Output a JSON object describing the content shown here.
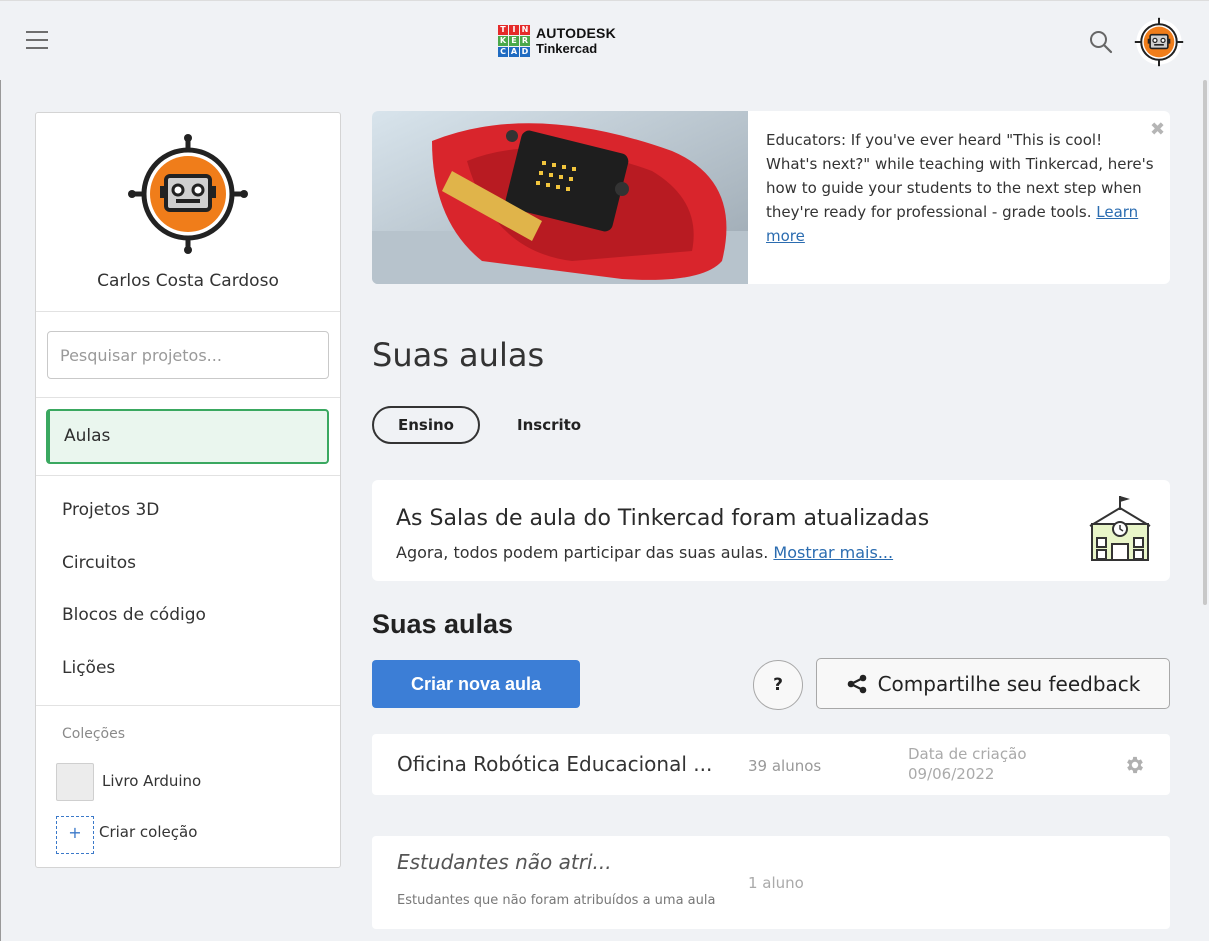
{
  "header": {
    "logo_letters": [
      "T",
      "I",
      "N",
      "K",
      "E",
      "R",
      "C",
      "A",
      "D"
    ],
    "logo_colors": [
      "#e52b2a",
      "#e52b2a",
      "#e52b2a",
      "#4aa84a",
      "#4aa84a",
      "#4aa84a",
      "#1f6bc1",
      "#1f6bc1",
      "#1f6bc1"
    ],
    "brand": "AUTODESK",
    "product": "Tinkercad"
  },
  "sidebar": {
    "user_name": "Carlos Costa Cardoso",
    "search_placeholder": "Pesquisar projetos...",
    "active_item": "Aulas",
    "nav_items": [
      "Projetos 3D",
      "Circuitos",
      "Blocos de código",
      "Lições"
    ],
    "collections_title": "Coleções",
    "collection_name": "Livro Arduino",
    "create_collection_icon": "+",
    "create_collection_label": "Criar coleção"
  },
  "banner": {
    "text": "Educators: If you've ever heard \"This is cool! What's next?\" while teaching with Tinkercad, here's how to guide your students to the next step when they're ready for professional - grade tools. ",
    "link": "Learn more",
    "close": "✖"
  },
  "main": {
    "page_title": "Suas aulas",
    "tabs": [
      "Ensino",
      "Inscrito"
    ],
    "notice": {
      "title": "As Salas de aula do Tinkercad foram atualizadas",
      "body": "Agora, todos podem participar das suas aulas. ",
      "link": "Mostrar mais..."
    },
    "section_title": "Suas aulas",
    "create_button": "Criar nova aula",
    "help_button": "?",
    "feedback_button": "Compartilhe seu feedback",
    "classes": [
      {
        "name": "Oficina Robótica Educacional ...",
        "students": "39 alunos",
        "date_label": "Data de criação",
        "date": "09/06/2022"
      },
      {
        "name": "Estudantes não atri...",
        "students": "1 aluno",
        "description": "Estudantes que não foram atribuídos a uma aula"
      }
    ]
  },
  "colors": {
    "accent_green": "#3aa860",
    "primary_blue": "#3c7ed6",
    "avatar_orange": "#f07d1a",
    "background": "#f0f2f5"
  }
}
